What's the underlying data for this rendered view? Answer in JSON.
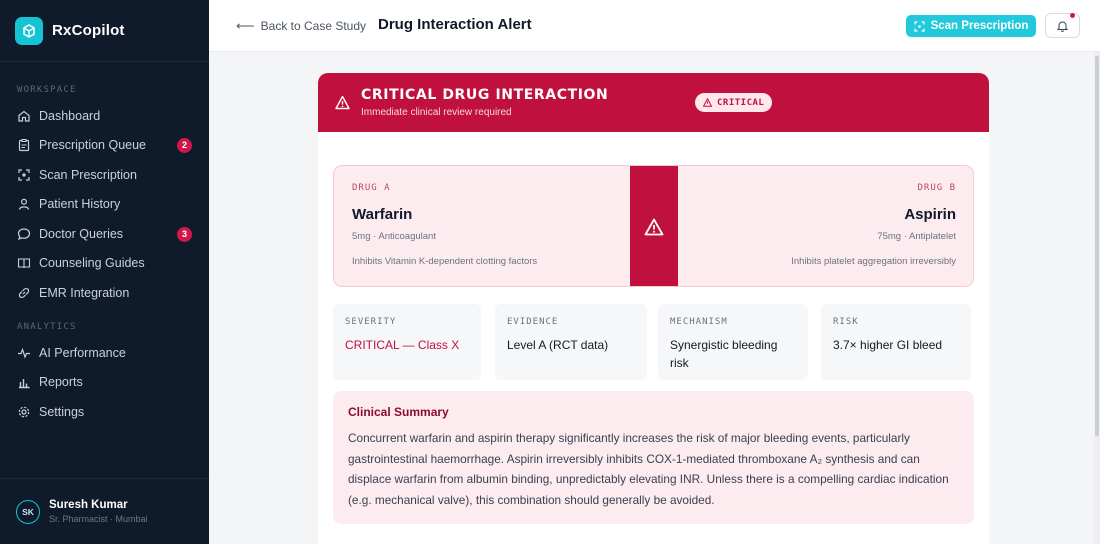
{
  "brand": {
    "name": "RxCopilot",
    "accent": "#16c3d4"
  },
  "sidebar": {
    "workspace_label": "WORKSPACE",
    "analytics_label": "ANALYTICS",
    "items": [
      {
        "label": "Dashboard",
        "icon": "home-icon"
      },
      {
        "label": "Prescription Queue",
        "icon": "clipboard-icon",
        "badge": "2"
      },
      {
        "label": "Scan Prescription",
        "icon": "scan-icon"
      },
      {
        "label": "Patient History",
        "icon": "user-icon"
      },
      {
        "label": "Doctor Queries",
        "icon": "chat-icon",
        "badge": "3"
      },
      {
        "label": "Counseling Guides",
        "icon": "book-icon"
      },
      {
        "label": "EMR Integration",
        "icon": "link-icon"
      }
    ],
    "analytics_items": [
      {
        "label": "AI Performance",
        "icon": "pulse-icon"
      },
      {
        "label": "Reports",
        "icon": "bar-chart-icon"
      },
      {
        "label": "Settings",
        "icon": "gear-icon"
      }
    ],
    "user": {
      "initials": "SK",
      "name": "Suresh Kumar",
      "role": "Sr. Pharmacist · Mumbai"
    }
  },
  "header": {
    "back_label": "Back to Case Study",
    "title": "Drug Interaction Alert",
    "scan_button": "Scan Prescription"
  },
  "alert": {
    "title": "CRITICAL DRUG INTERACTION",
    "subtitle": "Immediate clinical review required",
    "badge": "CRITICAL",
    "color": "#c0103d"
  },
  "drug_a": {
    "label": "DRUG A",
    "name": "Warfarin",
    "meta": "5mg · Anticoagulant",
    "effect": "Inhibits Vitamin K-dependent clotting factors"
  },
  "drug_b": {
    "label": "DRUG B",
    "name": "Aspirin",
    "meta": "75mg · Antiplatelet",
    "effect": "Inhibits platelet aggregation irreversibly"
  },
  "stats": [
    {
      "label": "SEVERITY",
      "value": "CRITICAL — Class X"
    },
    {
      "label": "EVIDENCE",
      "value": "Level A (RCT data)"
    },
    {
      "label": "MECHANISM",
      "value": "Synergistic bleeding risk"
    },
    {
      "label": "RISK",
      "value": "3.7× higher GI bleed"
    }
  ],
  "summary": {
    "title": "Clinical Summary",
    "text": "Concurrent warfarin and aspirin therapy significantly increases the risk of major bleeding events, particularly gastrointestinal haemorrhage. Aspirin irreversibly inhibits COX-1-mediated thromboxane A₂ synthesis and can displace warfarin from albumin binding, unpredictably elevating INR. Unless there is a compelling cardiac indication (e.g. mechanical valve), this combination should generally be avoided."
  }
}
